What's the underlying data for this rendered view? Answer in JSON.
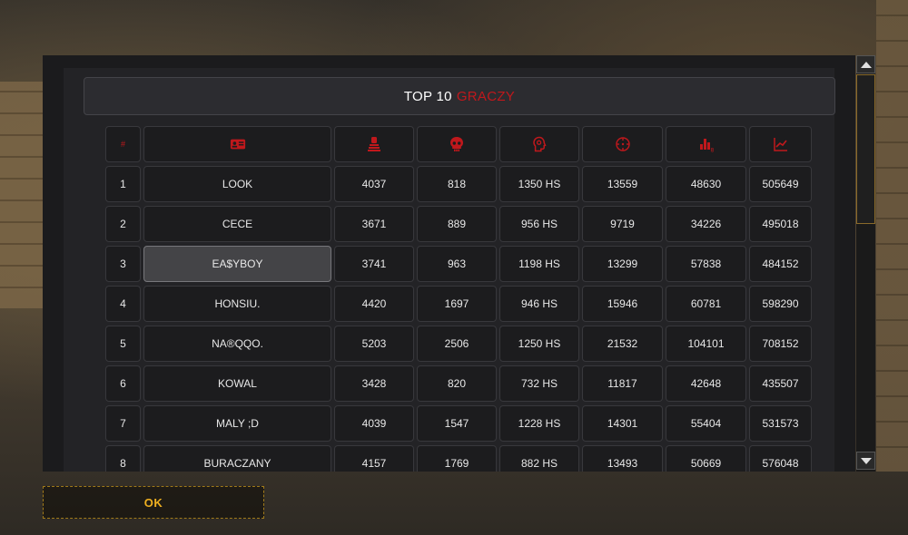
{
  "title": {
    "prefix": "TOP 10",
    "accent": "GRACZY"
  },
  "colors": {
    "accent": "#c0181c",
    "ok_text": "#f0b020",
    "panel": "#1b1b1d"
  },
  "columns": [
    {
      "header": "#",
      "icon": null
    },
    {
      "header": "",
      "icon": "player-card-icon"
    },
    {
      "header": "",
      "icon": "kills-icon"
    },
    {
      "header": "",
      "icon": "deaths-skull-icon"
    },
    {
      "header": "",
      "icon": "headshot-head-icon"
    },
    {
      "header": "",
      "icon": "crosshair-icon"
    },
    {
      "header": "",
      "icon": "damage-bars-icon"
    },
    {
      "header": "",
      "icon": "score-chart-icon"
    }
  ],
  "rows": [
    [
      "1",
      "LOOK",
      "4037",
      "818",
      "1350 HS",
      "13559",
      "48630",
      "505649"
    ],
    [
      "2",
      "CECE",
      "3671",
      "889",
      "956 HS",
      "9719",
      "34226",
      "495018"
    ],
    [
      "3",
      "EA$YBOY",
      "3741",
      "963",
      "1198 HS",
      "13299",
      "57838",
      "484152"
    ],
    [
      "4",
      "HONSIU.",
      "4420",
      "1697",
      "946 HS",
      "15946",
      "60781",
      "598290"
    ],
    [
      "5",
      "NA®QQO.",
      "5203",
      "2506",
      "1250 HS",
      "21532",
      "104101",
      "708152"
    ],
    [
      "6",
      "KOWAL",
      "3428",
      "820",
      "732 HS",
      "11817",
      "42648",
      "435507"
    ],
    [
      "7",
      "MALY ;D",
      "4039",
      "1547",
      "1228 HS",
      "14301",
      "55404",
      "531573"
    ],
    [
      "8",
      "BURACZANY",
      "4157",
      "1769",
      "882 HS",
      "13493",
      "50669",
      "576048"
    ]
  ],
  "highlighted_row": 2,
  "ok_button": {
    "label": "OK"
  }
}
